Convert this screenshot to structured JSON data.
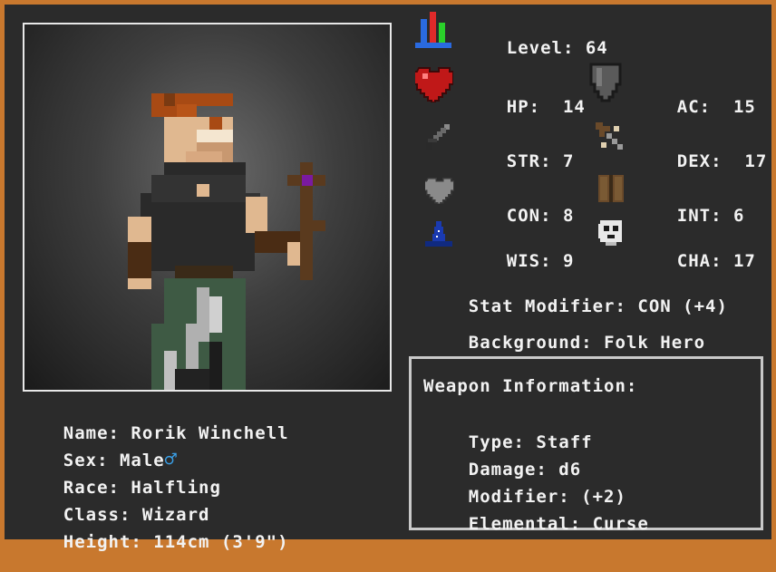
{
  "level": {
    "label": "Level:",
    "value": "64"
  },
  "stats": {
    "hp": {
      "label": "HP:",
      "value": "14",
      "icon": "heart-icon"
    },
    "ac": {
      "label": "AC:",
      "value": "15",
      "icon": "shield-icon"
    },
    "str": {
      "label": "STR:",
      "value": "7",
      "icon": "sword-icon"
    },
    "dex": {
      "label": "DEX:",
      "value": "17",
      "icon": "bow-icon"
    },
    "con": {
      "label": "CON:",
      "value": "8",
      "icon": "grey-heart-icon"
    },
    "int": {
      "label": "INT:",
      "value": "6",
      "icon": "book-icon"
    },
    "wis": {
      "label": "WIS:",
      "value": "9",
      "icon": "wizard-hat-icon"
    },
    "cha": {
      "label": "CHA:",
      "value": "17",
      "icon": "mask-icon"
    }
  },
  "stat_modifier": {
    "label": "Stat Modifier:",
    "value": "CON (+4)"
  },
  "background": {
    "label": "Background:",
    "value": "Folk Hero"
  },
  "character": {
    "name": {
      "label": "Name:",
      "value": "Rorik Winchell"
    },
    "sex": {
      "label": "Sex:",
      "value": "Male",
      "symbol": "♂"
    },
    "race": {
      "label": "Race:",
      "value": "Halfling"
    },
    "class": {
      "label": "Class:",
      "value": "Wizard"
    },
    "height": {
      "label": "Height:",
      "value": "114cm (3'9\")"
    }
  },
  "weapon": {
    "title": "Weapon Information:",
    "type": {
      "label": "Type:",
      "value": "Staff"
    },
    "damage": {
      "label": "Damage:",
      "value": "d6"
    },
    "modifier": {
      "label": "Modifier:",
      "value": "(+2)"
    },
    "elemental": {
      "label": "Elemental:",
      "value": "Curse"
    }
  },
  "colors": {
    "frame": "#c8782e",
    "panel": "#2b2b2b",
    "text": "#f2f2f2",
    "male_symbol": "#3aa0e8"
  }
}
